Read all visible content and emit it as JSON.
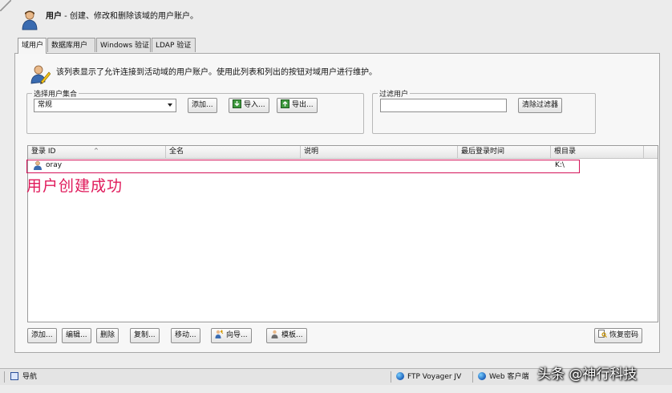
{
  "header": {
    "title": "用户",
    "subtitle": " - 创建、修改和删除该域的用户账户。"
  },
  "tabs": [
    {
      "label": "域用户",
      "active": true
    },
    {
      "label": "数据库用户",
      "active": false
    },
    {
      "label": "Windows 验证",
      "active": false
    },
    {
      "label": "LDAP 验证",
      "active": false
    }
  ],
  "info": {
    "text": "该列表显示了允许连接到活动域的用户账户。使用此列表和列出的按钮对域用户进行维护。"
  },
  "user_set": {
    "legend": "选择用户集合",
    "selected": "常规",
    "add_label": "添加...",
    "import_label": "导入...",
    "export_label": "导出..."
  },
  "filter": {
    "legend": "过滤用户",
    "value": "",
    "clear_label": "清除过滤器"
  },
  "table": {
    "columns": [
      "登录 ID",
      "全名",
      "说明",
      "最后登录时间",
      "根目录"
    ],
    "rows": [
      {
        "login_id": "oray",
        "full_name": "",
        "description": "",
        "last_login": "",
        "home_dir": "K:\\"
      }
    ]
  },
  "annotation": "用户创建成功",
  "actions": {
    "add": "添加...",
    "edit": "编辑...",
    "delete": "删除",
    "copy": "复制...",
    "move": "移动...",
    "wizard": "向导...",
    "template": "模板...",
    "restore_password": "恢复密码"
  },
  "statusbar": {
    "nav_label": "导航",
    "item1": "FTP Voyager JV",
    "item2": "Web 客户端"
  },
  "watermark": "头条 @神行科技",
  "colors": {
    "accent": "#d4145a",
    "annotation": "#e01a5b"
  }
}
